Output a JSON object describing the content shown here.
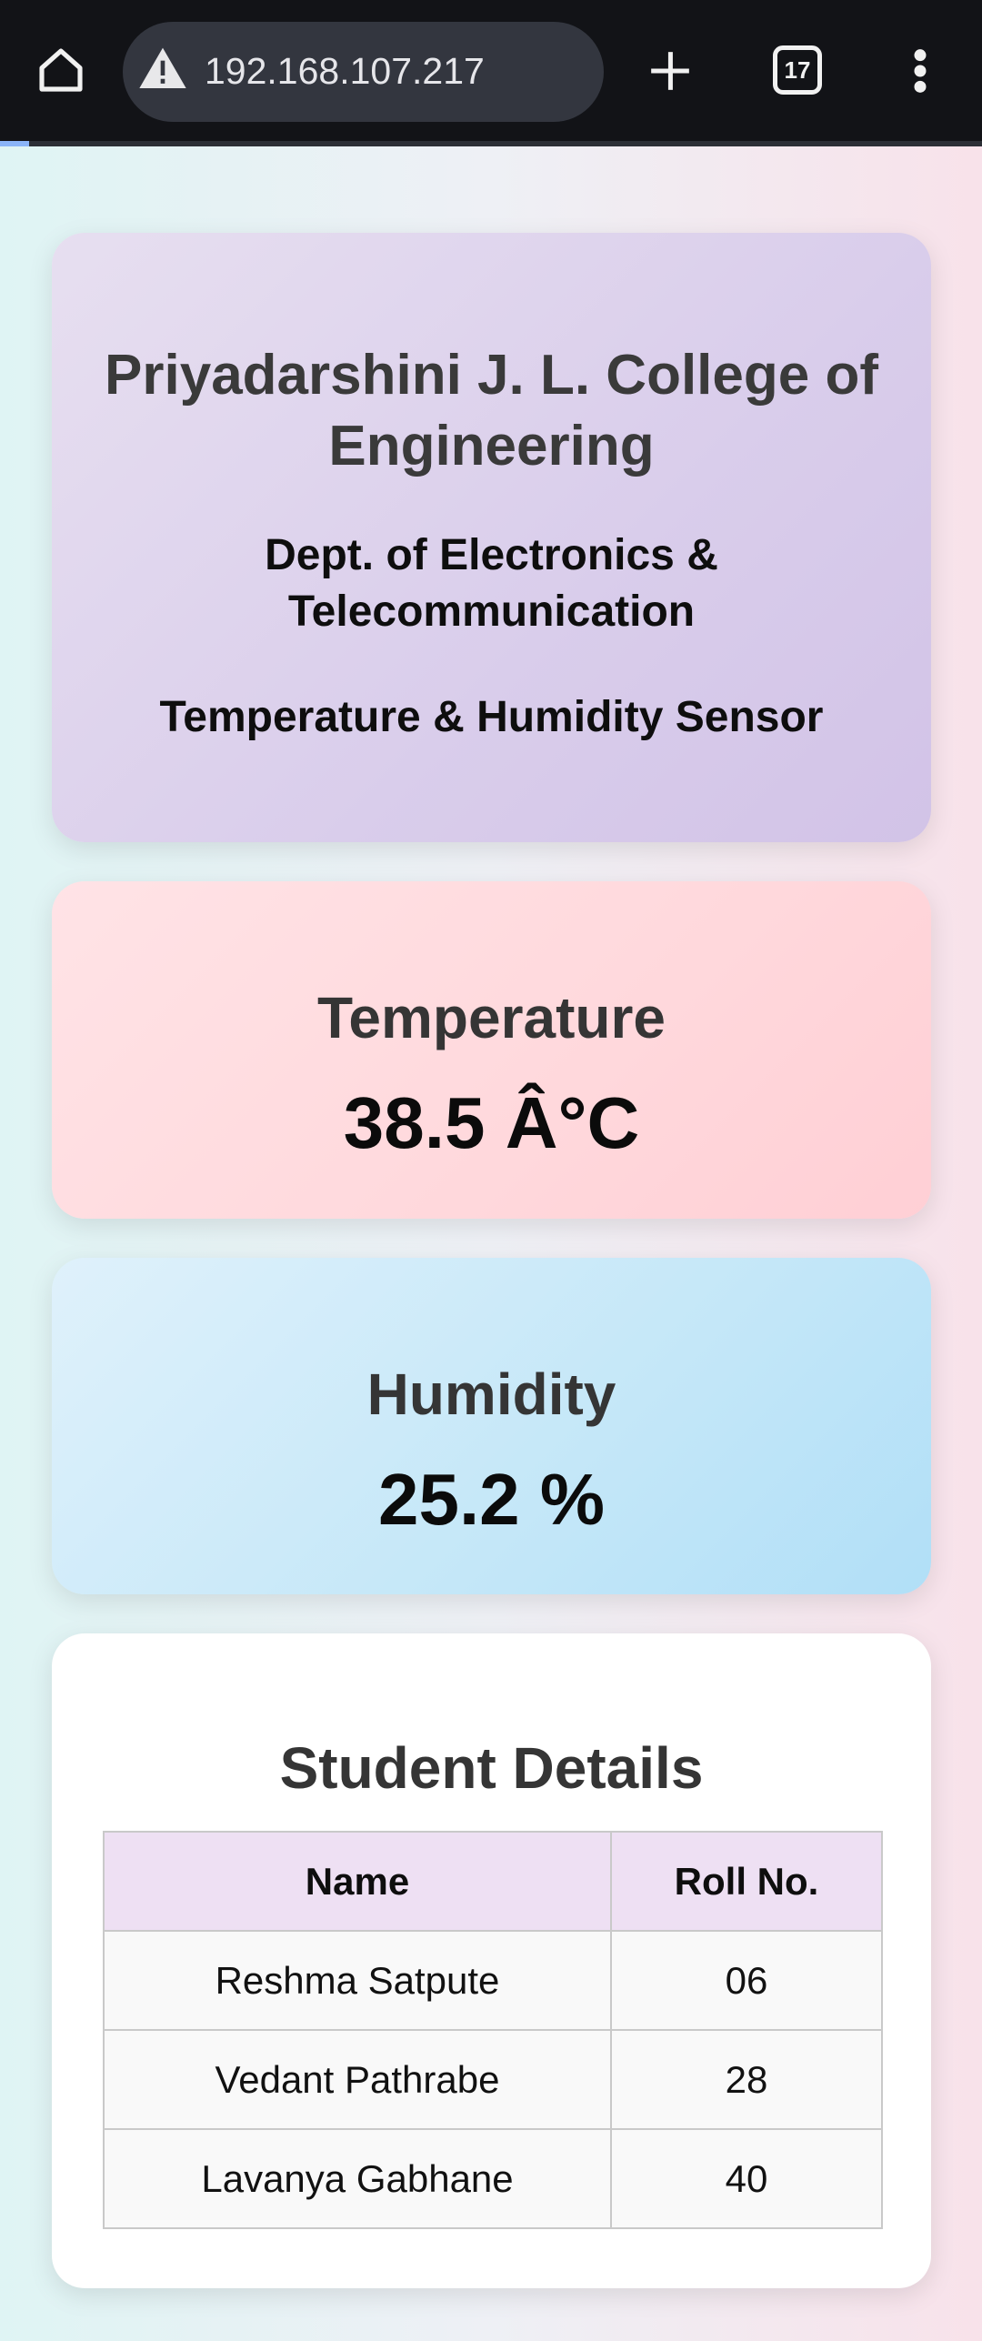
{
  "browser": {
    "url": "192.168.107.217",
    "tab_count": "17",
    "progress_fraction": 0.03
  },
  "header": {
    "college": "Priyadarshini J. L. College of Engineering",
    "department": "Dept. of Electronics & Telecommunication",
    "project": "Temperature & Humidity Sensor"
  },
  "temperature": {
    "label": "Temperature",
    "value": "38.5 Â°C"
  },
  "humidity": {
    "label": "Humidity",
    "value": "25.2 %"
  },
  "students": {
    "title": "Student Details",
    "columns": [
      "Name",
      "Roll No."
    ],
    "rows": [
      [
        "Reshma Satpute",
        "06"
      ],
      [
        "Vedant Pathrabe",
        "28"
      ],
      [
        "Lavanya Gabhane",
        "40"
      ]
    ]
  },
  "colors": {
    "chrome_bg": "#121317",
    "url_pill": "#33363f",
    "progress_accent": "#8ab4f8",
    "header_card": "#d9cdeb",
    "temp_card": "#ffd8dc",
    "humid_card": "#c4e7f8",
    "table_header": "#eee0f3"
  },
  "icons": {
    "home": "home-icon",
    "warning": "warning-triangle-icon",
    "new_tab": "plus-icon",
    "tabs": "tab-switcher-icon",
    "menu": "more-vert-icon"
  }
}
